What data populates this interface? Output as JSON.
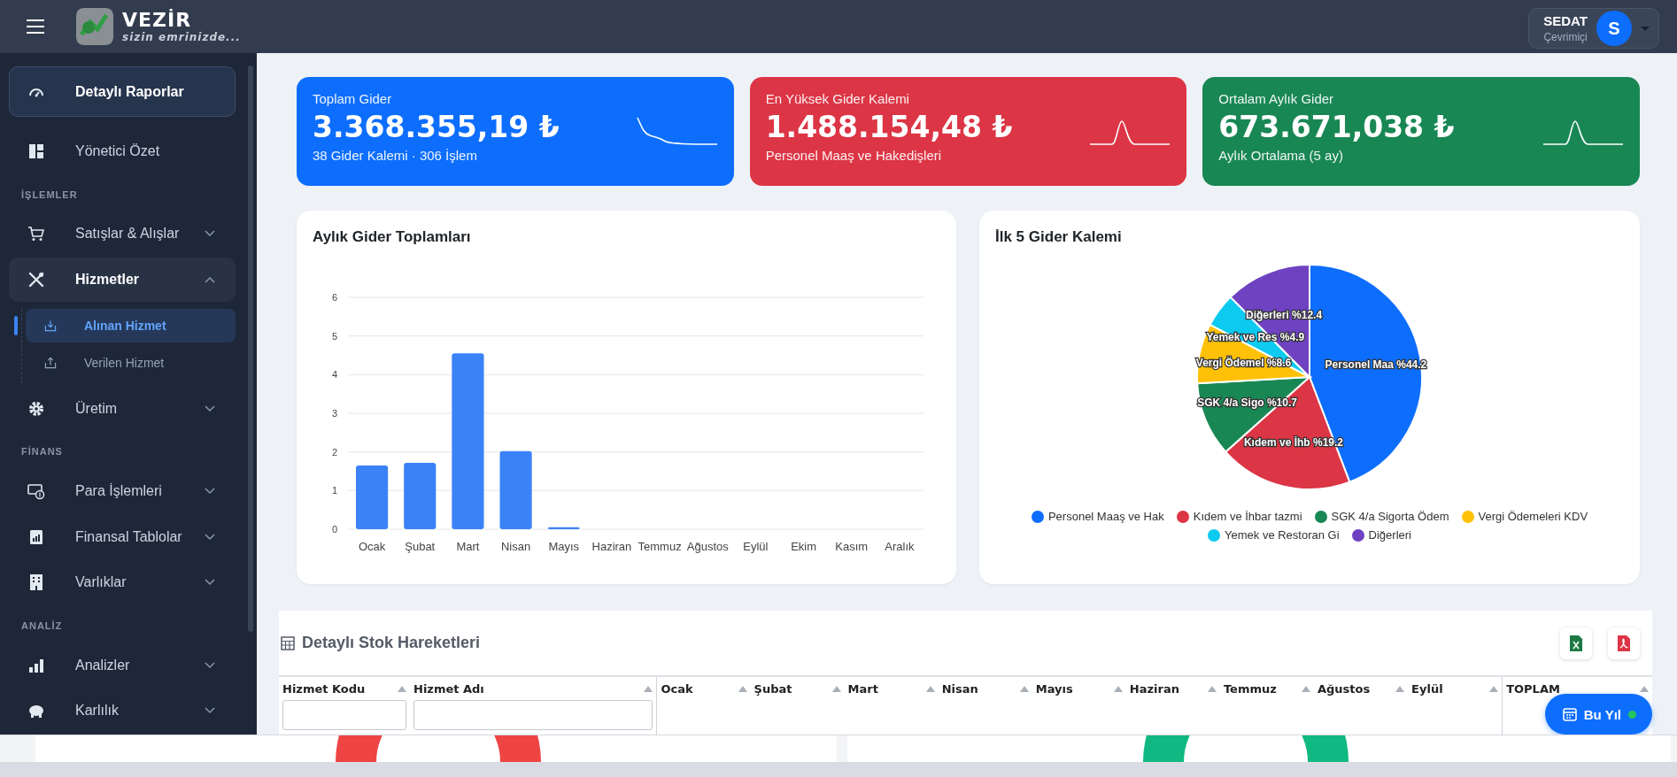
{
  "header": {
    "brand": "VEZİR",
    "tagline": "sizin emrinizde...",
    "user": {
      "name": "SEDAT",
      "status": "Çevrimiçi",
      "initial": "S"
    }
  },
  "sidebar": {
    "items": [
      {
        "kind": "item",
        "label": "Detaylı Raporlar",
        "selected": true
      },
      {
        "kind": "item",
        "label": "Yönetici Özet",
        "selected": false
      },
      {
        "kind": "section",
        "label": "İŞLEMLER"
      },
      {
        "kind": "item",
        "label": "Satışlar & Alışlar",
        "selected": false,
        "expanded": false
      },
      {
        "kind": "item",
        "label": "Hizmetler",
        "selected": false,
        "expanded": true,
        "children": [
          {
            "label": "Alınan Hizmet",
            "selected": true
          },
          {
            "label": "Verilen Hizmet",
            "selected": false
          }
        ]
      },
      {
        "kind": "item",
        "label": "Üretim",
        "selected": false,
        "expanded": false
      },
      {
        "kind": "section",
        "label": "FİNANS"
      },
      {
        "kind": "item",
        "label": "Para İşlemleri",
        "selected": false,
        "expanded": false
      },
      {
        "kind": "item",
        "label": "Finansal Tablolar",
        "selected": false,
        "expanded": false
      },
      {
        "kind": "item",
        "label": "Varlıklar",
        "selected": false,
        "expanded": false
      },
      {
        "kind": "section",
        "label": "ANALİZ"
      },
      {
        "kind": "item",
        "label": "Analizler",
        "selected": false,
        "expanded": false
      },
      {
        "kind": "item",
        "label": "Karlılık",
        "selected": false,
        "expanded": false
      }
    ]
  },
  "cards": [
    {
      "title": "Toplam Gider",
      "value": "3.368.355,19 ₺",
      "subtitle": "38 Gider Kalemi · 306 İşlem",
      "color": "#0d6efd"
    },
    {
      "title": "En Yüksek Gider Kalemi",
      "value": "1.488.154,48 ₺",
      "subtitle": "Personel Maaş ve Hakedişleri",
      "color": "#dc3545"
    },
    {
      "title": "Ortalam Aylık Gider",
      "value": "673.671,038 ₺",
      "subtitle": "Aylık Ortalama (5 ay)",
      "color": "#198754"
    }
  ],
  "monthly_chart": {
    "title": "Aylık Gider Toplamları",
    "chart_data": {
      "type": "bar",
      "categories": [
        "Ocak",
        "Şubat",
        "Mart",
        "Nisan",
        "Mayıs",
        "Haziran",
        "Temmuz",
        "Ağustos",
        "Eylül",
        "Ekim",
        "Kasım",
        "Aralık"
      ],
      "values": [
        1.65,
        1.72,
        4.55,
        2.02,
        0.05,
        0,
        0,
        0,
        0,
        0,
        0,
        0
      ],
      "ylim": [
        0,
        6
      ],
      "yticks": [
        0,
        1,
        2,
        3,
        4,
        5,
        6
      ],
      "grid": true
    }
  },
  "top_chart": {
    "title": "İlk 5 Gider Kalemi",
    "chart_data": {
      "type": "pie",
      "categories": [
        "Personel Maaş ve Hak",
        "Kıdem ve İhbar tazmi",
        "SGK 4/a Sigorta Ödem",
        "Vergi Ödemeleri KDV",
        "Yemek ve Restoran Gi",
        "Diğerleri"
      ],
      "values": [
        44.2,
        19.2,
        10.7,
        8.6,
        4.9,
        12.4
      ],
      "legend": "bottom",
      "colors": [
        "#0d6efd",
        "#dc3545",
        "#198754",
        "#ffc107",
        "#0dcaf0",
        "#6f42c1"
      ],
      "value_labels": [
        "Personel Maa %44.2",
        "Kıdem ve İhb %19.2",
        "SGK 4/a Sigo %10.7",
        "Vergi Ödemel %8.6",
        "Yemek ve Res %4.9",
        "Diğerleri %12.4"
      ]
    }
  },
  "table": {
    "title": "Detaylı Stok Hareketleri",
    "columns": [
      {
        "label": "Hizmet Kodu",
        "filter": true
      },
      {
        "label": "Hizmet Adı",
        "filter": true
      },
      {
        "label": "Ocak",
        "filter": false
      },
      {
        "label": "Şubat",
        "filter": false
      },
      {
        "label": "Mart",
        "filter": false
      },
      {
        "label": "Nisan",
        "filter": false
      },
      {
        "label": "Mayıs",
        "filter": false
      },
      {
        "label": "Haziran",
        "filter": false
      },
      {
        "label": "Temmuz",
        "filter": false
      },
      {
        "label": "Ağustos",
        "filter": false
      },
      {
        "label": "Eylül",
        "filter": false
      },
      {
        "label": "TOPLAM",
        "filter": false
      }
    ]
  },
  "period_button": {
    "label": "Bu Yıl"
  }
}
